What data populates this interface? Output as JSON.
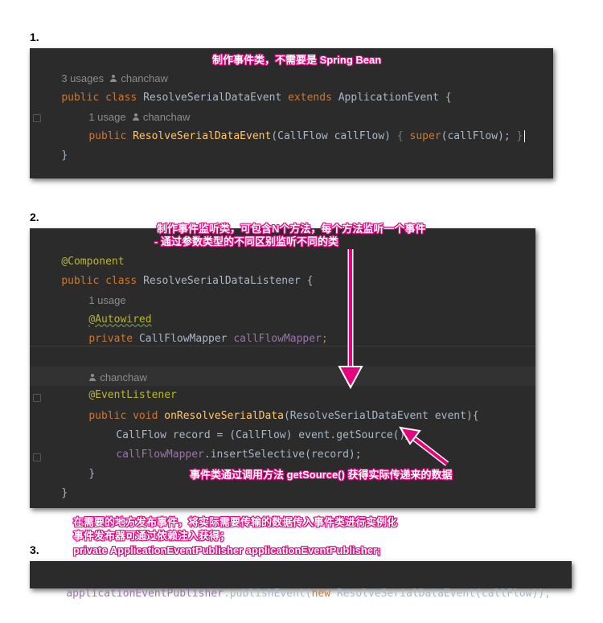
{
  "steps": {
    "one": "1.",
    "two": "2.",
    "three": "3."
  },
  "panel1": {
    "hint_usages": "3 usages",
    "hint_author": "chanchaw",
    "line_class": {
      "kw1": "public",
      "kw2": "class",
      "name": "ResolveSerialDataEvent",
      "kw3": "extends",
      "parent": "ApplicationEvent {"
    },
    "hint_usage2": "1 usage",
    "hint_author2": "chanchaw",
    "line_ctor": {
      "kw": "public",
      "fn": "ResolveSerialDataEvent",
      "params": "(CallFlow callFlow) ",
      "brace": "{ ",
      "super": "super",
      "args": "(callFlow);",
      "end": " }"
    },
    "line_close": "}",
    "callout": "制作事件类，不需要是 Spring Bean"
  },
  "panel2": {
    "ann_component": "@Component",
    "line_class": {
      "kw1": "public",
      "kw2": "class",
      "name": "ResolveSerialDataListener {"
    },
    "hint_usage": "1 usage",
    "ann_autowired": "@Autowired",
    "line_field": {
      "kw": "private",
      "type": "CallFlowMapper",
      "field": "callFlowMapper",
      "end": ";"
    },
    "hint_author": "chanchaw",
    "ann_event": "@EventListener",
    "line_method": {
      "kw1": "public",
      "kw2": "void",
      "fn": "onResolveSerialData",
      "params": "(ResolveSerialDataEvent event){"
    },
    "line_record": {
      "code": "CallFlow record = (CallFlow) event.getSource()",
      "end": ";"
    },
    "line_insert": {
      "field": "callFlowMapper",
      "code": ".insertSelective(record);"
    },
    "line_close_method": "}",
    "line_close_class": "}",
    "callout_top1": "制作事件监听类，可包含N个方法，每个方法监听一个事件",
    "callout_top2": "- 通过参数类型的不同区别监听不同的类",
    "callout_bottom": "事件类通过调用方法 getSource() 获得实际传递来的数据"
  },
  "note3": {
    "line1": "在需要的地方发布事件，将实际需要传输的数据传入事件类进行实例化",
    "line2": "事件发布器可通过依赖注入获得；",
    "line3": "private ApplicationEventPublisher applicationEventPublisher;"
  },
  "panel3": {
    "field": "applicationEventPublisher",
    "call": ".publishEvent(",
    "kw": "new",
    "rest": " ResolveSerialDataEvent(callFlow));"
  },
  "colors": {
    "editor_bg": "#2b2b2b",
    "accent_pink": "#e6007e",
    "keyword": "#cc7832",
    "method": "#ffc66d",
    "annotation": "#bbb529",
    "field": "#9876aa"
  }
}
